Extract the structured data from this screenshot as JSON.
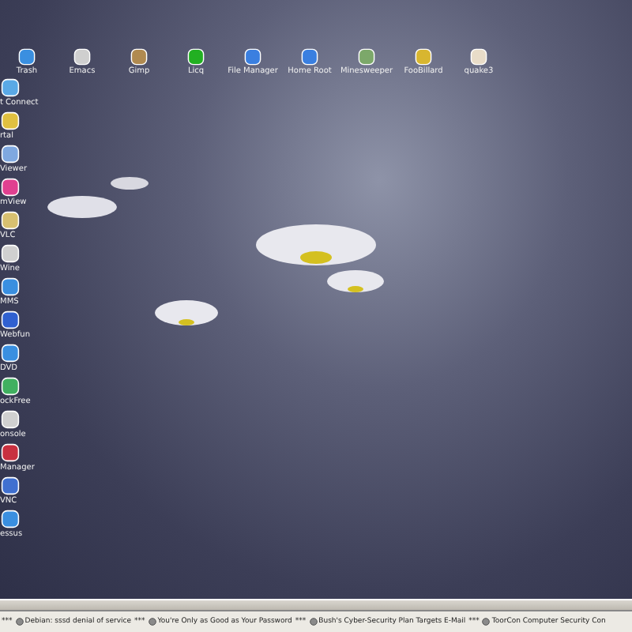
{
  "desktop": {
    "top_icons": [
      {
        "label": "Trash"
      },
      {
        "label": "Emacs"
      },
      {
        "label": "Gimp"
      },
      {
        "label": "Licq"
      },
      {
        "label": "File Manager"
      },
      {
        "label": "Home Root"
      },
      {
        "label": "Minesweeper"
      },
      {
        "label": "FooBillard"
      },
      {
        "label": "quake3"
      }
    ],
    "left_icons": [
      {
        "label": "t Connect"
      },
      {
        "label": "rtal"
      },
      {
        "label": "Viewer"
      },
      {
        "label": "mView"
      },
      {
        "label": "VLC"
      },
      {
        "label": "Wine"
      },
      {
        "label": "MMS"
      },
      {
        "label": "Webfun"
      },
      {
        "label": "DVD"
      },
      {
        "label": "ockFree"
      },
      {
        "label": "onsole"
      },
      {
        "label": "Manager"
      },
      {
        "label": "VNC"
      },
      {
        "label": "essus"
      }
    ]
  },
  "ticker": [
    {
      "kind": "separator",
      "text": "***"
    },
    {
      "kind": "headline",
      "text": "Debian: sssd denial of service"
    },
    {
      "kind": "separator",
      "text": "***"
    },
    {
      "kind": "headline",
      "text": "You're Only as Good as Your Password"
    },
    {
      "kind": "separator",
      "text": "***"
    },
    {
      "kind": "headline",
      "text": "Bush's Cyber-Security Plan Targets E-Mail"
    },
    {
      "kind": "separator",
      "text": "***"
    },
    {
      "kind": "headline",
      "text": "ToorCon Computer Security Con"
    }
  ]
}
